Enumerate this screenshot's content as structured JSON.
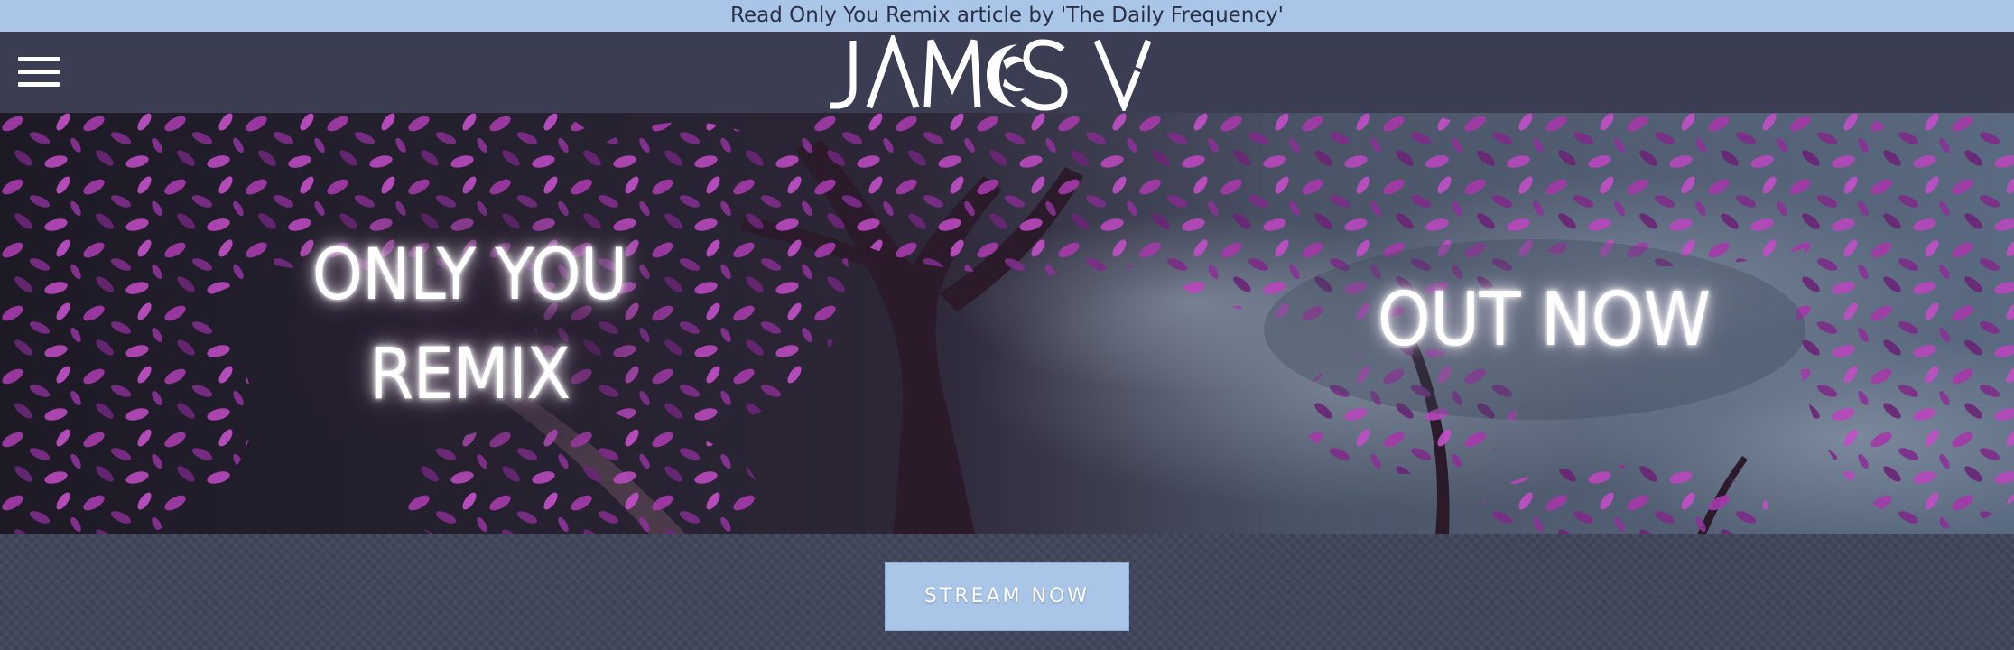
{
  "announcement": {
    "text": "Read Only You Remix article by 'The Daily Frequency'"
  },
  "header": {
    "menu_icon": "hamburger-menu-icon",
    "logo_text": "JAMES V"
  },
  "hero": {
    "left_line_1": "ONLY YOU",
    "left_line_2": "REMIX",
    "right_text": "OUT NOW"
  },
  "cta": {
    "label": "STREAM NOW"
  },
  "colors": {
    "announcement_bg": "#a9c6e8",
    "header_bg": "#3b3d52",
    "page_bg": "#3f4357",
    "button_bg": "#a9c6e8",
    "foliage_accent": "#b03bb8"
  }
}
